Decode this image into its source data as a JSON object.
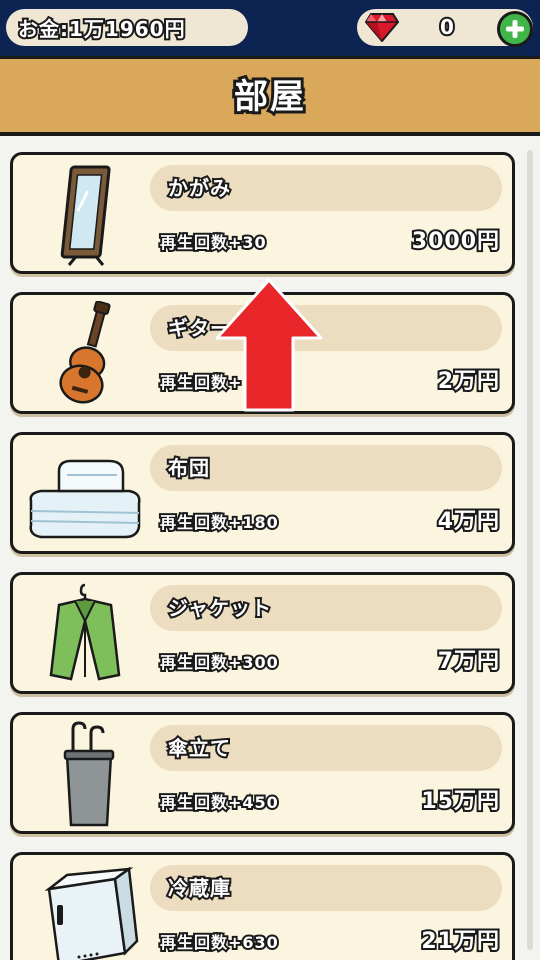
{
  "header": {
    "money_text": "お金:1万1960円",
    "gem_count": "0",
    "title": "部屋"
  },
  "items": [
    {
      "name": "かがみ",
      "plays": "再生回数+30",
      "price": "3000円",
      "icon": "mirror-icon"
    },
    {
      "name": "ギター",
      "plays": "再生回数+",
      "price": "2万円",
      "icon": "guitar-icon"
    },
    {
      "name": "布団",
      "plays": "再生回数+180",
      "price": "4万円",
      "icon": "futon-icon"
    },
    {
      "name": "ジャケット",
      "plays": "再生回数+300",
      "price": "7万円",
      "icon": "jacket-icon"
    },
    {
      "name": "傘立て",
      "plays": "再生回数+450",
      "price": "15万円",
      "icon": "umbrella-stand-icon"
    },
    {
      "name": "冷蔵庫",
      "plays": "再生回数+630",
      "price": "21万円",
      "icon": "fridge-icon"
    }
  ],
  "colors": {
    "topbar": "#0d2352",
    "banner": "#d9a85a",
    "card": "#fbf5df",
    "pill": "#ecdcc0",
    "arrow": "#e8262a"
  }
}
